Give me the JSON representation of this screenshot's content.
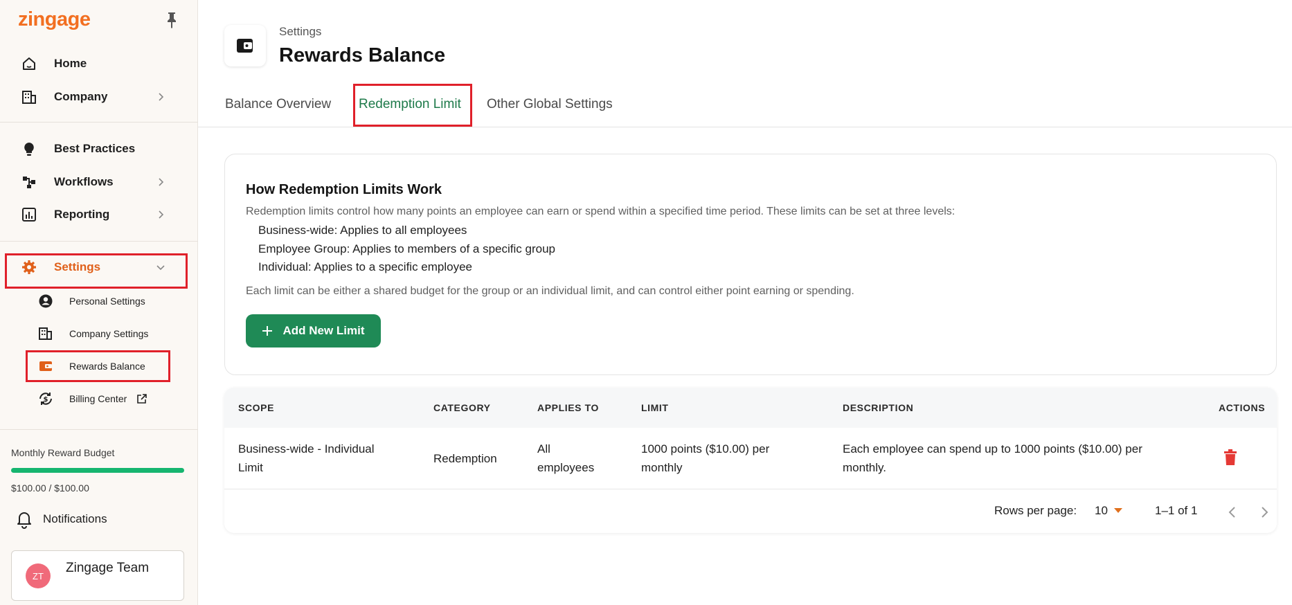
{
  "sidebar": {
    "logo": "zingage",
    "nav": {
      "home": "Home",
      "company": "Company",
      "best_practices": "Best Practices",
      "workflows": "Workflows",
      "reporting": "Reporting",
      "settings": "Settings"
    },
    "settings_sub": {
      "personal": "Personal Settings",
      "company": "Company Settings",
      "rewards": "Rewards Balance",
      "billing": "Billing Center"
    },
    "budget": {
      "label": "Monthly Reward Budget",
      "value": "$100.00 / $100.00",
      "progress": 1.0
    },
    "notifications": "Notifications",
    "user": {
      "initials": "ZT",
      "name": "Zingage Team"
    }
  },
  "header": {
    "breadcrumb": "Settings",
    "title": "Rewards Balance"
  },
  "tabs": [
    {
      "label": "Balance Overview",
      "active": false
    },
    {
      "label": "Redemption Limit",
      "active": true
    },
    {
      "label": "Other Global Settings",
      "active": false
    }
  ],
  "info": {
    "title": "How Redemption Limits Work",
    "description": "Redemption limits control how many points an employee can earn or spend within a specified time period. These limits can be set at three levels:",
    "levels": [
      "Business-wide: Applies to all employees",
      "Employee Group: Applies to members of a specific group",
      "Individual: Applies to a specific employee"
    ],
    "note": "Each limit can be either a shared budget for the group or an individual limit, and can control either point earning or spending.",
    "add_button": "Add New Limit"
  },
  "table": {
    "columns": [
      "SCOPE",
      "CATEGORY",
      "APPLIES TO",
      "LIMIT",
      "DESCRIPTION",
      "ACTIONS"
    ],
    "rows": [
      {
        "scope_l1": "Business-wide - Individual",
        "scope_l2": "Limit",
        "category": "Redemption",
        "applies_l1": "All",
        "applies_l2": "employees",
        "limit_l1": "1000 points ($10.00) per",
        "limit_l2": "monthly",
        "desc_l1": "Each employee can spend up to 1000 points ($10.00) per",
        "desc_l2": "monthly."
      }
    ],
    "pagination": {
      "rows_per_page_label": "Rows per page:",
      "rows_per_page": "10",
      "range": "1–1 of 1"
    }
  },
  "colors": {
    "brand": "#f26f21",
    "primary_green": "#1f8a56",
    "active_tab": "#1e7a4a",
    "delete": "#e53935",
    "highlight": "#e0202a"
  }
}
